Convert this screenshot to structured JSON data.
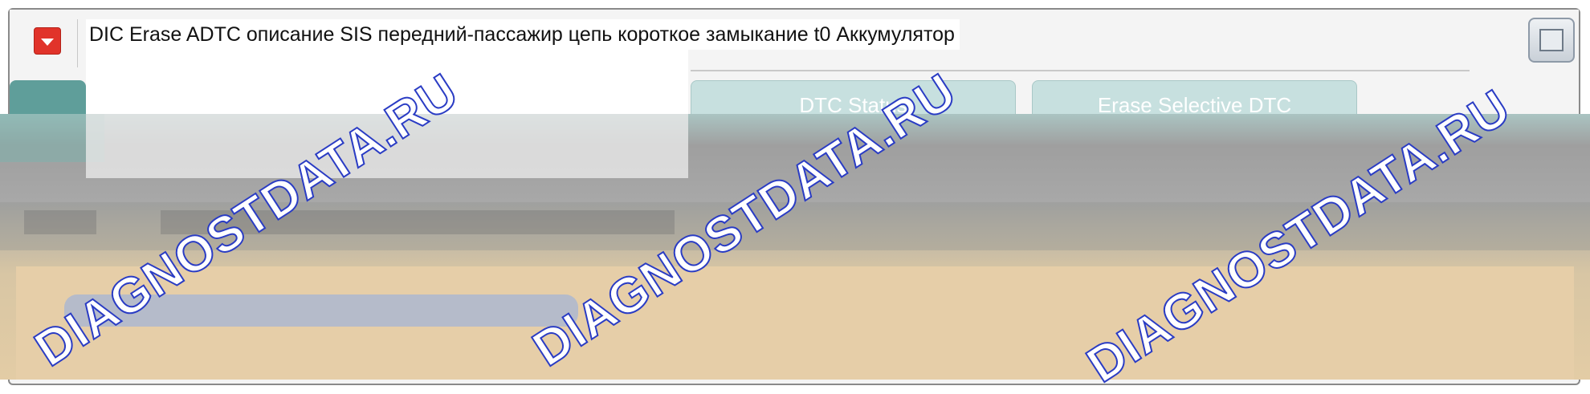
{
  "header": {
    "title": "DIC Erase ADTC описание SIS передний-пассажир цепь короткое замыкание t0 Аккумулятор"
  },
  "tabs": [
    {
      "label": ""
    },
    {
      "label": "DTC Status"
    },
    {
      "label": "Erase Selective DTC"
    }
  ],
  "watermark": {
    "text": "DIAGNOSTDATA.RU",
    "color": "#2a3cc4"
  },
  "colors": {
    "accent": "#e1332a",
    "tab_active": "#5f9e9a",
    "tab_inactive": "#c7e0df"
  }
}
